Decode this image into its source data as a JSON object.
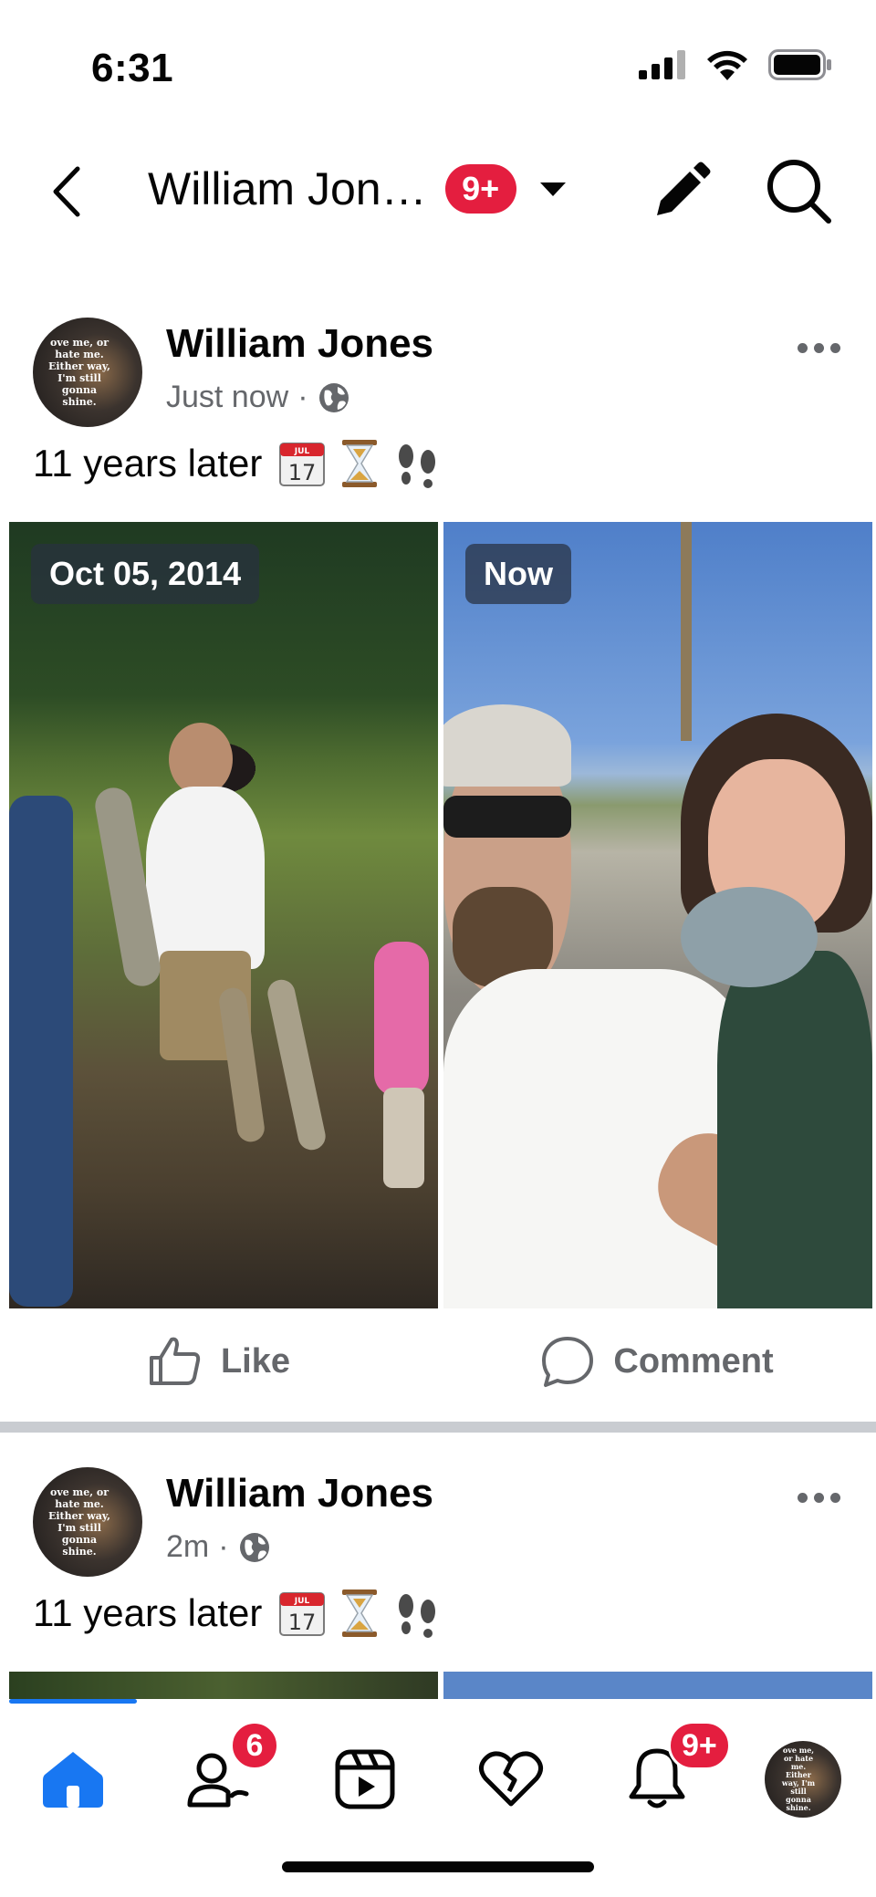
{
  "status_bar": {
    "time": "6:31"
  },
  "header": {
    "title": "William Jon…",
    "notification_badge": "9+",
    "icons": {
      "back": "chevron-left-icon",
      "edit": "pencil-icon",
      "search": "search-icon",
      "dropdown": "caret-down-icon"
    }
  },
  "profile": {
    "avatar_text": "ove me, or hate me. Either way, I'm still gonna shine."
  },
  "posts": [
    {
      "author": "William Jones",
      "timestamp": "Just now",
      "privacy": "globe-icon",
      "text": "11 years later",
      "emojis": [
        "📆",
        "⏳",
        "👣"
      ],
      "photos": [
        {
          "badge": "Oct 05, 2014"
        },
        {
          "badge": "Now"
        }
      ],
      "actions": {
        "like": "Like",
        "comment": "Comment"
      }
    },
    {
      "author": "William Jones",
      "timestamp": "2m",
      "privacy": "globe-icon",
      "text": "11 years later",
      "emojis": [
        "📆",
        "⏳",
        "👣"
      ]
    }
  ],
  "bottom_nav": {
    "items": [
      {
        "name": "home",
        "icon": "home-icon",
        "active": true
      },
      {
        "name": "friends",
        "icon": "friends-icon",
        "badge": "6"
      },
      {
        "name": "video",
        "icon": "video-icon"
      },
      {
        "name": "dating",
        "icon": "heart-icon"
      },
      {
        "name": "notifications",
        "icon": "bell-icon",
        "badge": "9+"
      },
      {
        "name": "profile",
        "icon": "avatar"
      }
    ]
  },
  "colors": {
    "accent": "#1877f2",
    "badge": "#e41e3f",
    "secondary_text": "#65676b",
    "divider": "#c9ccd1"
  }
}
